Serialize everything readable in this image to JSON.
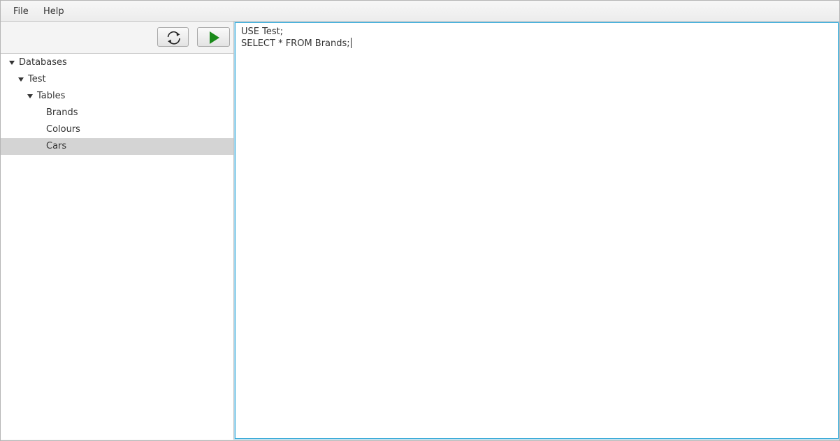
{
  "menubar": {
    "items": [
      {
        "label": "File"
      },
      {
        "label": "Help"
      }
    ]
  },
  "toolbar": {
    "refresh_icon": "refresh-icon",
    "run_icon": "play-icon",
    "run_color": "#1a8a1a"
  },
  "tree": {
    "root": {
      "label": "Databases",
      "expanded": true
    },
    "database": {
      "label": "Test",
      "expanded": true
    },
    "tables_folder": {
      "label": "Tables",
      "expanded": true
    },
    "tables": [
      {
        "label": "Brands",
        "selected": false
      },
      {
        "label": "Colours",
        "selected": false
      },
      {
        "label": "Cars",
        "selected": true
      }
    ]
  },
  "editor": {
    "lines": [
      "USE Test;",
      "SELECT * FROM Brands;"
    ],
    "focus_color": "#2fa6d6"
  }
}
